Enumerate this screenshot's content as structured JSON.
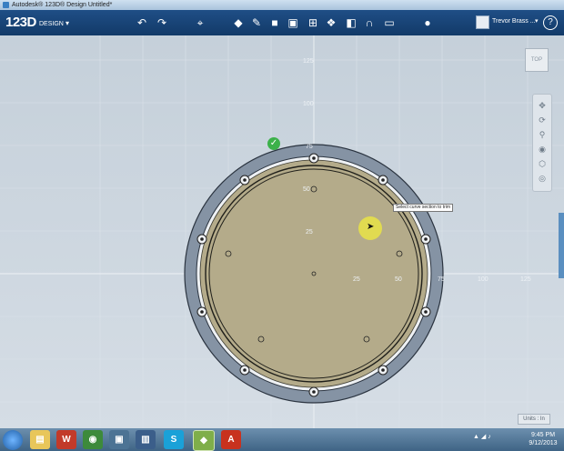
{
  "window": {
    "title": "Autodesk® 123D® Design Untitled*"
  },
  "toolbar": {
    "brand": "123D",
    "brand_sub": "DESIGN",
    "user_name": "Trevor Brass ..."
  },
  "viewport": {
    "view_label": "TOP",
    "tooltip": "Select curve section to trim",
    "units": "Units : In",
    "axis_y_labels": [
      "125",
      "100",
      "75",
      "50",
      "25"
    ],
    "axis_x_labels": [
      "25",
      "50",
      "75",
      "100",
      "125"
    ]
  },
  "taskbar": {
    "time": "9:45 PM",
    "date": "9/12/2013"
  },
  "colors": {
    "accent": "#1f4e86",
    "ring_outer": "#8593a4",
    "disk_fill": "#b4ab8a",
    "check": "#3cb14a"
  }
}
